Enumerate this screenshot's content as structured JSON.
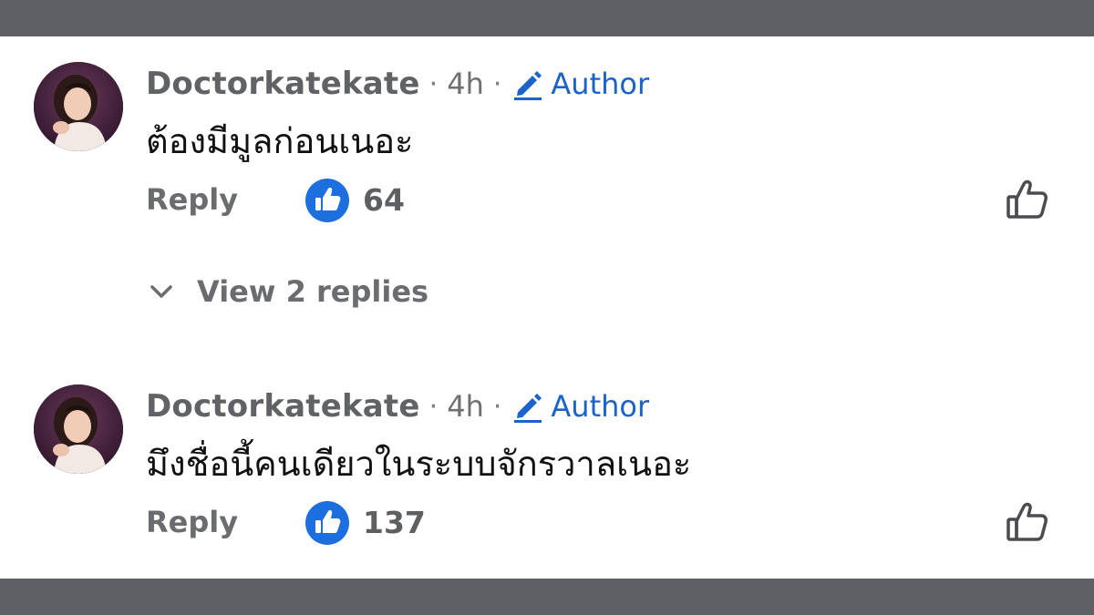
{
  "comments": [
    {
      "author_name": "Doctorkatekate",
      "separator": "·",
      "time": "4h",
      "badge_label": "Author",
      "text": "ต้องมีมูลก่อนเนอะ",
      "reply_label": "Reply",
      "like_count": "64",
      "view_replies_label": "View 2 replies"
    },
    {
      "author_name": "Doctorkatekate",
      "separator": "·",
      "time": "4h",
      "badge_label": "Author",
      "text": "มึงชื่อนี้คนเดียวในระบบจักรวาลเนอะ",
      "reply_label": "Reply",
      "like_count": "137"
    }
  ],
  "icons": {
    "badge": "pencil-icon",
    "reaction": "thumbs-up-icon",
    "like_action": "thumbs-up-outline-icon",
    "expand": "chevron-down-icon"
  },
  "colors": {
    "accent_blue": "#1b62c9",
    "like_badge_blue": "#1d6fe0",
    "frame_gray": "#5f6064"
  }
}
